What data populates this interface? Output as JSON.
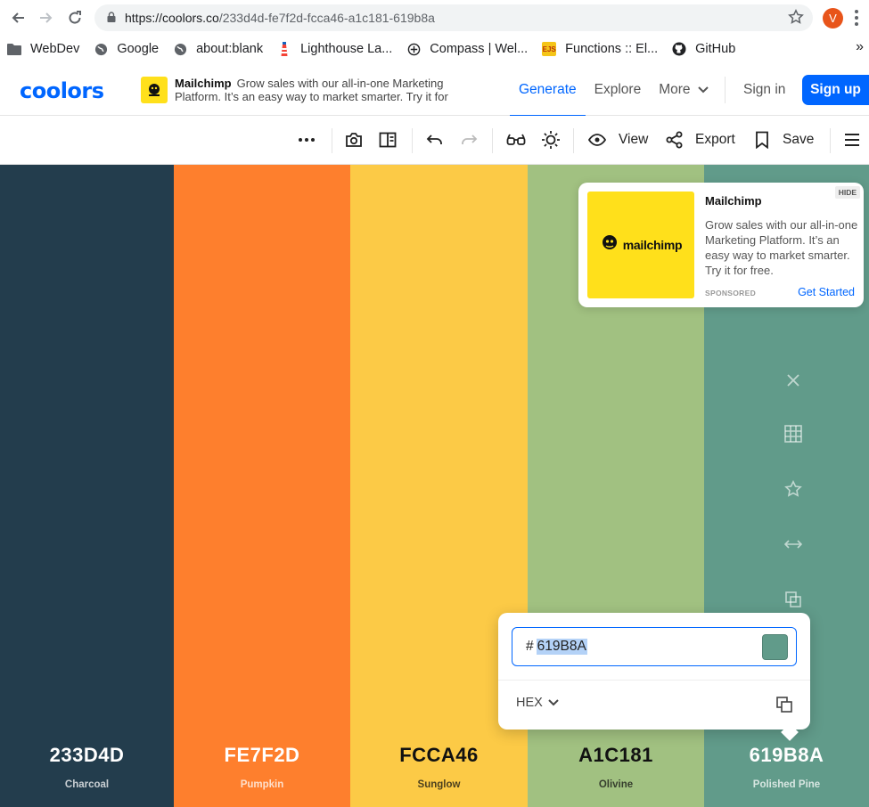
{
  "browser": {
    "url_host": "https://coolors.co",
    "url_path": "/233d4d-fe7f2d-fcca46-a1c181-619b8a",
    "avatar_letter": "V",
    "bookmarks": [
      {
        "label": "WebDev",
        "icon": "folder-icon"
      },
      {
        "label": "Google",
        "icon": "globe-icon"
      },
      {
        "label": "about:blank",
        "icon": "globe-icon"
      },
      {
        "label": "Lighthouse La...",
        "icon": "lighthouse-icon"
      },
      {
        "label": "Compass | Wel...",
        "icon": "compass-icon"
      },
      {
        "label": "Functions :: El...",
        "icon": "ejs-icon",
        "icon_text": "EJS"
      },
      {
        "label": "GitHub",
        "icon": "github-icon"
      }
    ],
    "bookmarks_more": "»"
  },
  "header": {
    "logo": "coolors",
    "ad": {
      "brand": "Mailchimp",
      "text": "Grow sales with our all-in-one Marketing Platform. It’s an easy way to market smarter. Try it for"
    },
    "nav": [
      {
        "label": "Generate",
        "active": true
      },
      {
        "label": "Explore",
        "active": false
      },
      {
        "label": "More",
        "active": false
      }
    ],
    "signin": "Sign in",
    "signup": "Sign up"
  },
  "toolbar": {
    "view_label": "View",
    "export_label": "Export",
    "save_label": "Save"
  },
  "palette": [
    {
      "hex": "233D4D",
      "name": "Charcoal",
      "color": "#233d4d",
      "text_color": "#ffffff"
    },
    {
      "hex": "FE7F2D",
      "name": "Pumpkin",
      "color": "#fe7f2d",
      "text_color": "#ffffff"
    },
    {
      "hex": "FCCA46",
      "name": "Sunglow",
      "color": "#fcca46",
      "text_color": "#111111"
    },
    {
      "hex": "A1C181",
      "name": "Olivine",
      "color": "#a1c181",
      "text_color": "#111111"
    },
    {
      "hex": "619B8A",
      "name": "Polished Pine",
      "color": "#619b8a",
      "text_color": "#ffffff"
    }
  ],
  "ad_card": {
    "hide": "HIDE",
    "image_brand": "mailchimp",
    "title": "Mailchimp",
    "body": "Grow sales with our all-in-one Marketing Platform. It’s an easy way to market smarter. Try it for free.",
    "sponsored": "SPONSORED",
    "cta": "Get Started"
  },
  "picker": {
    "hash": "#",
    "value": "619B8A",
    "chip_color": "#619b8a",
    "mode": "HEX"
  },
  "accent_color": "#0066ff"
}
